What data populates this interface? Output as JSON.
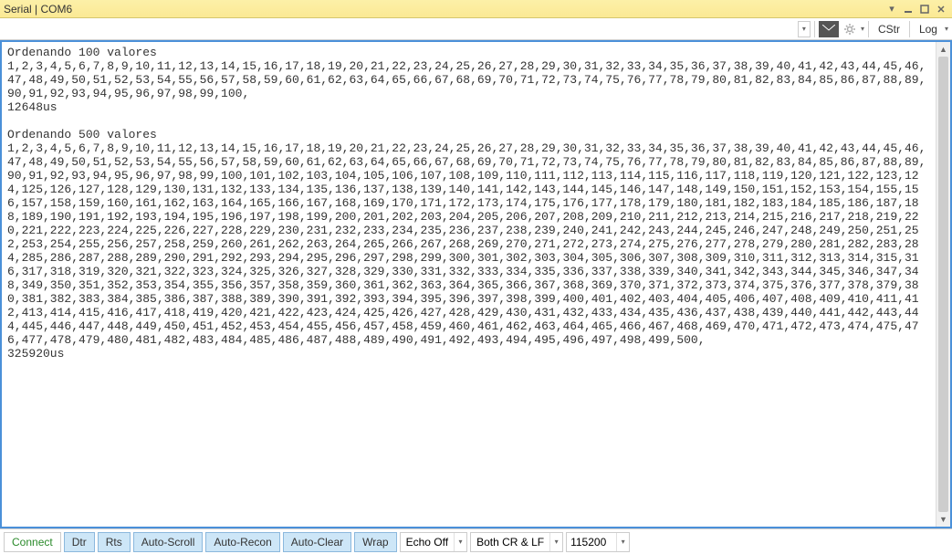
{
  "titlebar": {
    "title": "Serial | COM6"
  },
  "toolbar": {
    "cstr": "CStr",
    "log": "Log"
  },
  "terminal": {
    "content": "Ordenando 100 valores\n1,2,3,4,5,6,7,8,9,10,11,12,13,14,15,16,17,18,19,20,21,22,23,24,25,26,27,28,29,30,31,32,33,34,35,36,37,38,39,40,41,42,43,44,45,46,47,48,49,50,51,52,53,54,55,56,57,58,59,60,61,62,63,64,65,66,67,68,69,70,71,72,73,74,75,76,77,78,79,80,81,82,83,84,85,86,87,88,89,90,91,92,93,94,95,96,97,98,99,100,\n12648us\n\nOrdenando 500 valores\n1,2,3,4,5,6,7,8,9,10,11,12,13,14,15,16,17,18,19,20,21,22,23,24,25,26,27,28,29,30,31,32,33,34,35,36,37,38,39,40,41,42,43,44,45,46,47,48,49,50,51,52,53,54,55,56,57,58,59,60,61,62,63,64,65,66,67,68,69,70,71,72,73,74,75,76,77,78,79,80,81,82,83,84,85,86,87,88,89,90,91,92,93,94,95,96,97,98,99,100,101,102,103,104,105,106,107,108,109,110,111,112,113,114,115,116,117,118,119,120,121,122,123,124,125,126,127,128,129,130,131,132,133,134,135,136,137,138,139,140,141,142,143,144,145,146,147,148,149,150,151,152,153,154,155,156,157,158,159,160,161,162,163,164,165,166,167,168,169,170,171,172,173,174,175,176,177,178,179,180,181,182,183,184,185,186,187,188,189,190,191,192,193,194,195,196,197,198,199,200,201,202,203,204,205,206,207,208,209,210,211,212,213,214,215,216,217,218,219,220,221,222,223,224,225,226,227,228,229,230,231,232,233,234,235,236,237,238,239,240,241,242,243,244,245,246,247,248,249,250,251,252,253,254,255,256,257,258,259,260,261,262,263,264,265,266,267,268,269,270,271,272,273,274,275,276,277,278,279,280,281,282,283,284,285,286,287,288,289,290,291,292,293,294,295,296,297,298,299,300,301,302,303,304,305,306,307,308,309,310,311,312,313,314,315,316,317,318,319,320,321,322,323,324,325,326,327,328,329,330,331,332,333,334,335,336,337,338,339,340,341,342,343,344,345,346,347,348,349,350,351,352,353,354,355,356,357,358,359,360,361,362,363,364,365,366,367,368,369,370,371,372,373,374,375,376,377,378,379,380,381,382,383,384,385,386,387,388,389,390,391,392,393,394,395,396,397,398,399,400,401,402,403,404,405,406,407,408,409,410,411,412,413,414,415,416,417,418,419,420,421,422,423,424,425,426,427,428,429,430,431,432,433,434,435,436,437,438,439,440,441,442,443,444,445,446,447,448,449,450,451,452,453,454,455,456,457,458,459,460,461,462,463,464,465,466,467,468,469,470,471,472,473,474,475,476,477,478,479,480,481,482,483,484,485,486,487,488,489,490,491,492,493,494,495,496,497,498,499,500,\n325920us\n"
  },
  "bottombar": {
    "connect": "Connect",
    "dtr": "Dtr",
    "rts": "Rts",
    "autoscroll": "Auto-Scroll",
    "autorecon": "Auto-Recon",
    "autoclear": "Auto-Clear",
    "wrap": "Wrap",
    "echo": "Echo Off",
    "crlf": "Both CR & LF",
    "baud": "115200"
  }
}
